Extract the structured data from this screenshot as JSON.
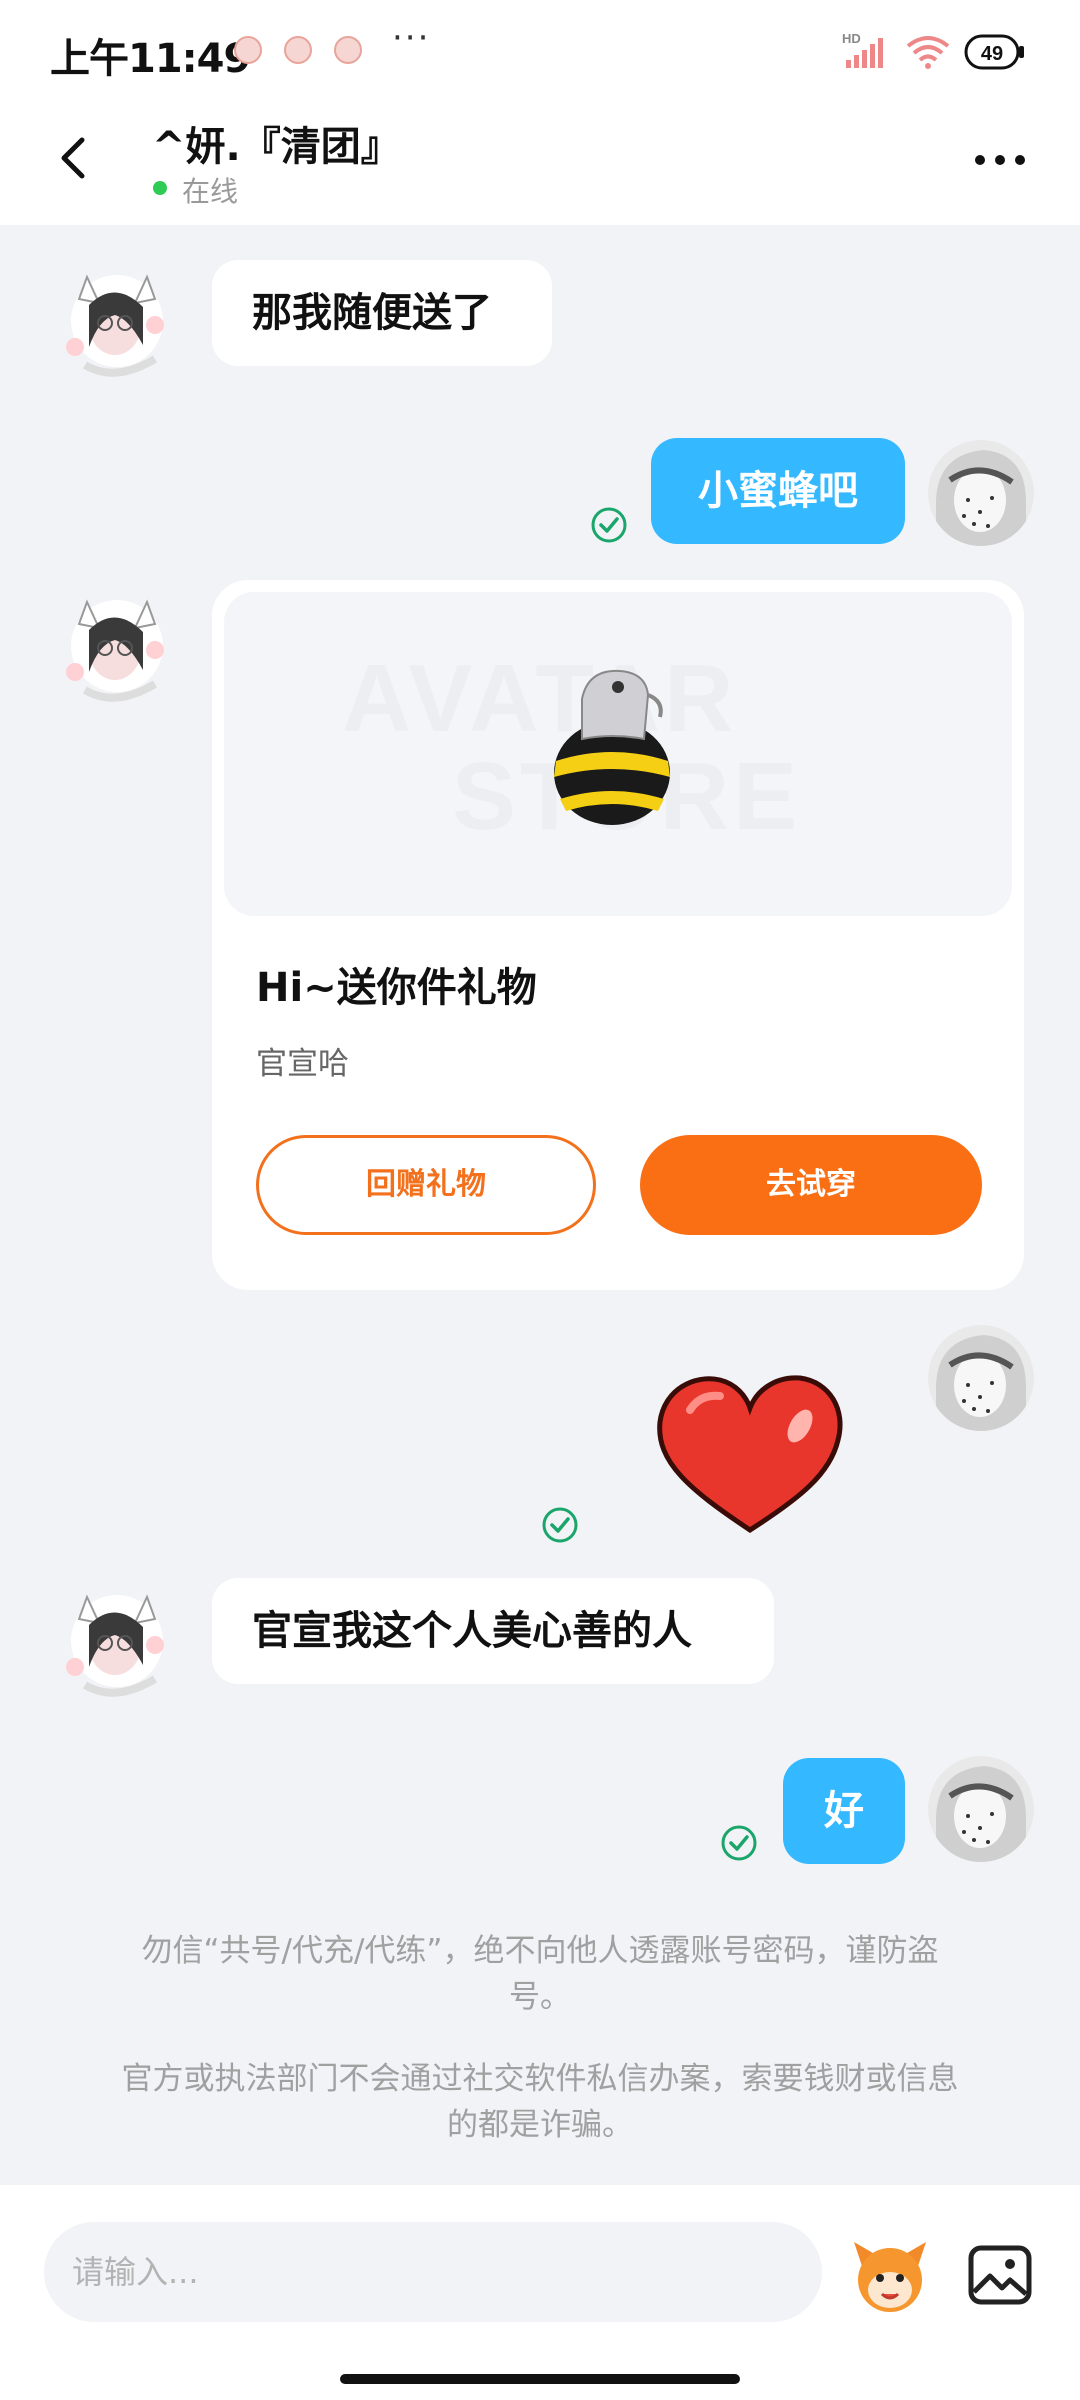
{
  "status_bar": {
    "time": "上午11:49",
    "overflow": "···",
    "battery": "49",
    "icons": [
      "notification-icon",
      "notification-icon",
      "notification-icon",
      "hd-signal-icon",
      "wifi-icon",
      "battery-icon"
    ]
  },
  "header": {
    "title": "^妍.『清团』",
    "status": "在线",
    "back_icon": "back-arrow-icon",
    "more_icon": "more-dots-icon"
  },
  "messages": [
    {
      "side": "left",
      "type": "text",
      "text": "那我随便送了"
    },
    {
      "side": "right",
      "type": "text",
      "text": "小蜜蜂吧",
      "read": true
    },
    {
      "side": "left",
      "type": "gift",
      "watermark_line1": "AVATAR",
      "watermark_line2": "STORE",
      "title": "Hi~送你件礼物",
      "subtitle": "官宣哈",
      "return_button": "回赠礼物",
      "try_button": "去试穿"
    },
    {
      "side": "right",
      "type": "sticker",
      "sticker": "heart-sticker",
      "read": true
    },
    {
      "side": "left",
      "type": "text",
      "text": "官宣我这个人美心善的人"
    },
    {
      "side": "right",
      "type": "text",
      "text": "好",
      "read": true
    }
  ],
  "notices": [
    {
      "line1": "勿信“共号/代充/代练”，绝不向他人透露账号密码，谨防盗",
      "line2": "号。"
    },
    {
      "line1": "官方或执法部门不会通过社交软件私信办案，索要钱财或信息",
      "line2": "的都是诈骗。"
    }
  ],
  "input": {
    "placeholder": "请输入...",
    "emoji_icon": "emoji-face-icon",
    "image_icon": "image-icon"
  },
  "colors": {
    "accent_blue": "#34b8ff",
    "accent_orange": "#fa6e14",
    "online_green": "#2ecc55",
    "read_check": "#1aa56a"
  }
}
